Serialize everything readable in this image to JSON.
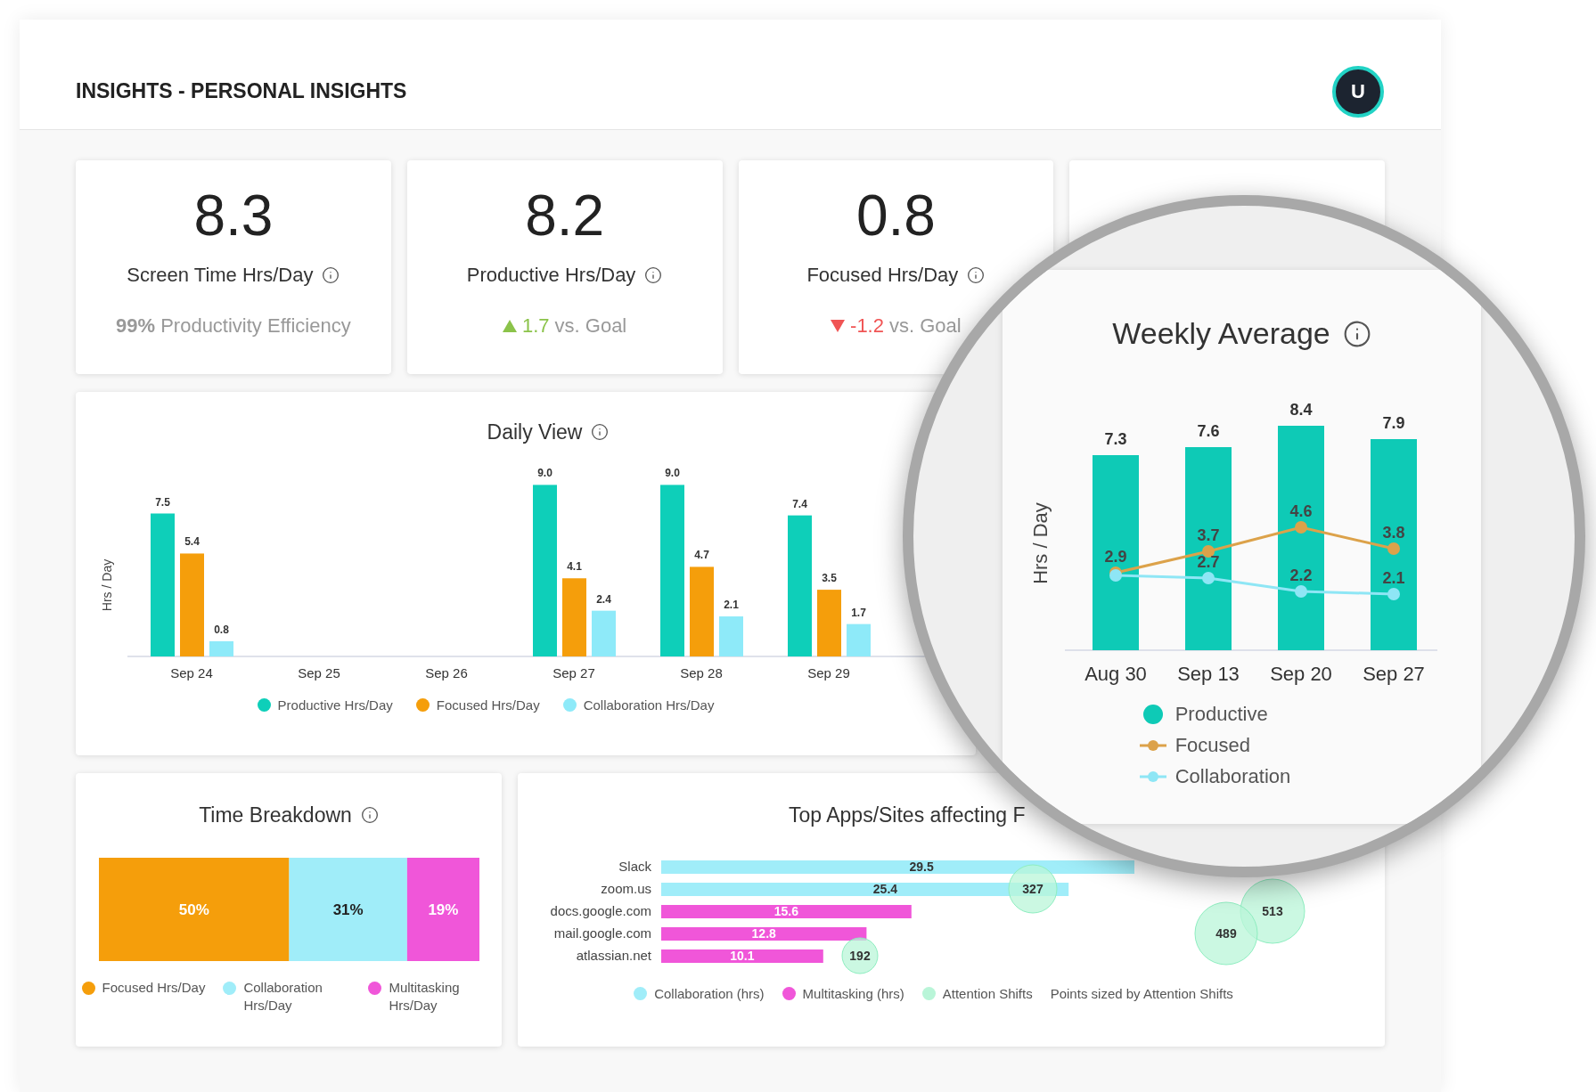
{
  "header": {
    "title": "INSIGHTS - PERSONAL INSIGHTS",
    "avatar": "U"
  },
  "kpis": [
    {
      "value": "8.3",
      "label": "Screen Time Hrs/Day",
      "kind": "plain",
      "note": "**99%** Productivity Efficiency"
    },
    {
      "value": "8.2",
      "label": "Productive Hrs/Day",
      "kind": "up",
      "delta": "1.7",
      "note": "vs. Goal"
    },
    {
      "value": "0.8",
      "label": "Focused Hrs/Day",
      "kind": "down",
      "delta": "-1.2",
      "note": "vs. Goal"
    }
  ],
  "daily_view": {
    "title": "Daily View",
    "chart_data": {
      "type": "bar",
      "ylabel": "Hrs / Day",
      "categories": [
        "Sep 24",
        "Sep 25",
        "Sep 26",
        "Sep 27",
        "Sep 28",
        "Sep 29"
      ],
      "data_labels": true,
      "series": [
        {
          "name": "Productive Hrs/Day",
          "color": "#0ecfb9",
          "values": [
            7.5,
            null,
            null,
            9.0,
            9.0,
            7.4
          ],
          "value_labels": [
            "7.5",
            null,
            null,
            "9.0",
            "9.0",
            "7.4"
          ]
        },
        {
          "name": "Focused Hrs/Day",
          "color": "#f59e0b",
          "values": [
            5.4,
            null,
            null,
            4.1,
            4.7,
            3.5
          ],
          "value_labels": [
            "5.4",
            null,
            null,
            "4.1",
            "4.7",
            "3.5"
          ]
        },
        {
          "name": "Collaboration Hrs/Day",
          "color": "#8eeaf9",
          "values": [
            0.8,
            null,
            null,
            2.4,
            2.1,
            1.7
          ],
          "value_labels": [
            "0.8",
            null,
            null,
            "2.4",
            "2.1",
            "1.7"
          ]
        }
      ]
    }
  },
  "time_breakdown": {
    "title": "Time Breakdown",
    "chart_data": {
      "type": "bar",
      "stacked": true,
      "orientation": "horizontal",
      "series": [
        {
          "name": "Focused Hrs/Day",
          "color": "#f59e0b",
          "values": [
            0.5
          ],
          "value_labels": [
            "50%"
          ]
        },
        {
          "name": "Collaboration Hrs/Day",
          "color": "#a0edf9",
          "values": [
            0.31
          ],
          "value_labels": [
            "31%"
          ]
        },
        {
          "name": "Multitasking Hrs/Day",
          "color": "#f056d9",
          "values": [
            0.19
          ],
          "value_labels": [
            "19%"
          ]
        }
      ]
    }
  },
  "top_apps": {
    "title": "Top Apps/Sites affecting F",
    "chart_data": {
      "type": "bar",
      "orientation": "horizontal",
      "categories": [
        "Slack",
        "zoom.us",
        "docs.google.com",
        "mail.google.com",
        "atlassian.net"
      ],
      "data_labels": true,
      "annotations": [
        "Points sized by Attention Shifts"
      ],
      "series": [
        {
          "name": "Collaboration (hrs)",
          "color": "#a0edf9",
          "type": "bar",
          "values": [
            29.5,
            25.4,
            null,
            null,
            null
          ],
          "value_labels": [
            "29.5",
            "25.4",
            null,
            null,
            null
          ]
        },
        {
          "name": "Multitasking (hrs)",
          "color": "#f056d9",
          "type": "bar",
          "values": [
            null,
            null,
            15.6,
            12.8,
            10.1
          ],
          "value_labels": [
            null,
            null,
            "15.6",
            "12.8",
            "10.1"
          ]
        }
      ]
    },
    "attention_legend": {
      "name": "Attention Shifts",
      "color": "#b9f5d8"
    },
    "attention_shifts": [
      "327",
      "513",
      "489",
      "192"
    ]
  },
  "weekly_average": {
    "title": "Weekly Average",
    "chart_data": {
      "type": "bar",
      "ylabel": "Hrs / Day",
      "categories": [
        "Aug 30",
        "Sep 13",
        "Sep 20",
        "Sep 27"
      ],
      "series": [
        {
          "name": "Productive",
          "color": "#0ecab6",
          "type": "bar",
          "values": [
            7.3,
            7.6,
            8.4,
            7.9
          ],
          "value_labels": [
            "7.3",
            "7.6",
            "8.4",
            "7.9"
          ]
        },
        {
          "name": "Focused",
          "color": "#dca24a",
          "type": "line",
          "values": [
            2.9,
            3.7,
            4.6,
            3.8
          ],
          "value_labels": [
            "2.9",
            "3.7",
            "4.6",
            "3.8"
          ],
          "marker": true
        },
        {
          "name": "Collaboration",
          "color": "#8ee6f5",
          "type": "line",
          "values": [
            2.8,
            2.7,
            2.2,
            2.1
          ],
          "value_labels": [
            null,
            "2.7",
            "2.2",
            "2.1"
          ],
          "marker": true
        }
      ]
    }
  }
}
